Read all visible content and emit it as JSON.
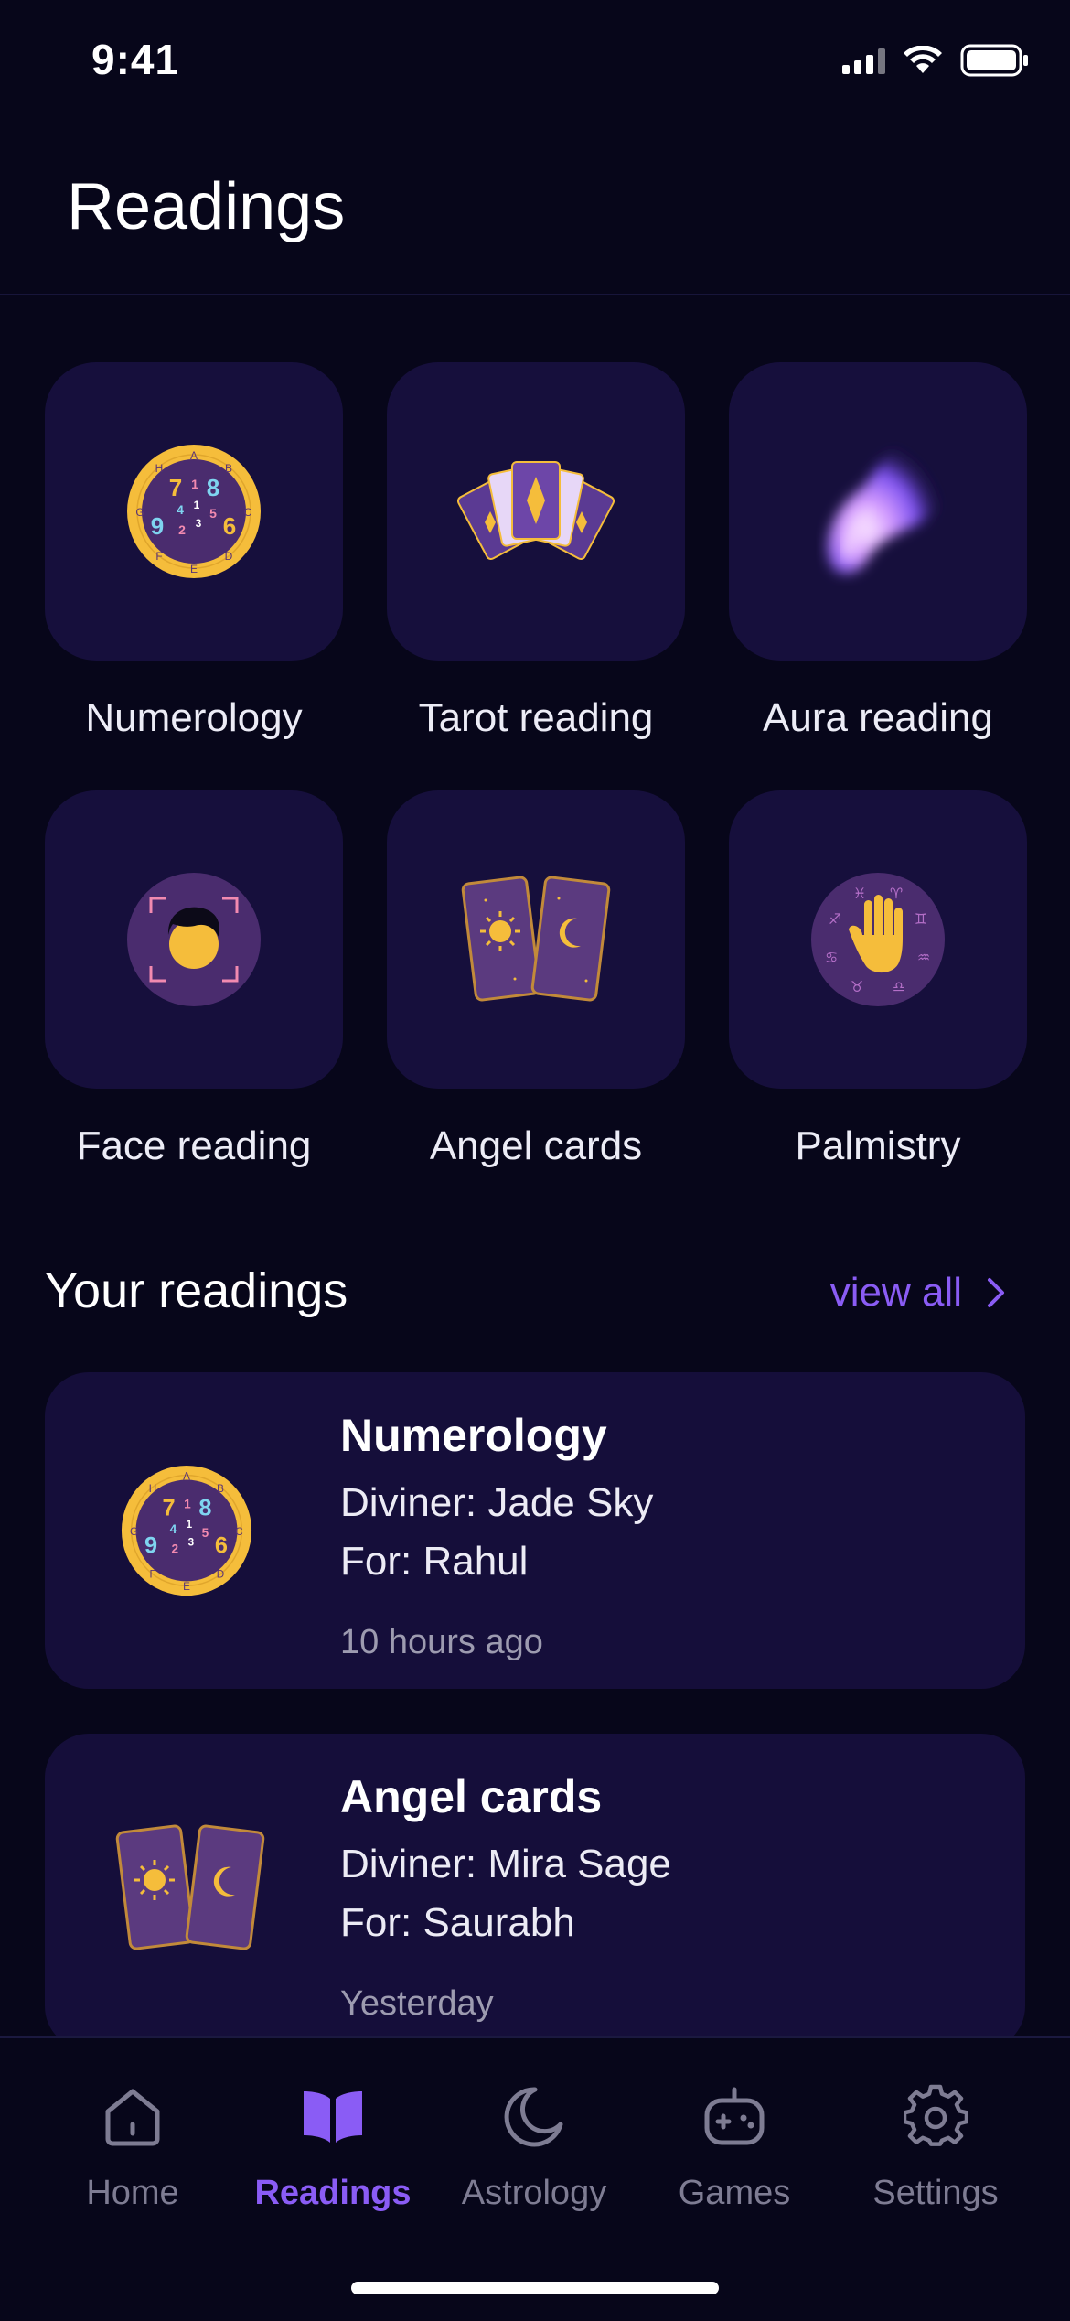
{
  "status_bar": {
    "time": "9:41"
  },
  "header": {
    "title": "Readings"
  },
  "reading_types": [
    {
      "label": "Numerology",
      "icon": "numerology-wheel-icon"
    },
    {
      "label": "Tarot reading",
      "icon": "tarot-cards-icon"
    },
    {
      "label": "Aura reading",
      "icon": "aura-flame-icon"
    },
    {
      "label": "Face reading",
      "icon": "face-scan-icon"
    },
    {
      "label": "Angel cards",
      "icon": "angel-cards-icon"
    },
    {
      "label": "Palmistry",
      "icon": "palm-zodiac-icon"
    }
  ],
  "your_readings": {
    "title": "Your readings",
    "view_all": "view all",
    "items": [
      {
        "title": "Numerology",
        "diviner": "Diviner: Jade Sky",
        "for": "For: Rahul",
        "time": "10 hours ago",
        "icon": "numerology-wheel-icon"
      },
      {
        "title": "Angel cards",
        "diviner": "Diviner: Mira Sage",
        "for": "For: Saurabh",
        "time": "Yesterday",
        "icon": "angel-cards-icon"
      }
    ]
  },
  "tab_bar": {
    "tabs": [
      {
        "label": "Home",
        "icon": "home-icon",
        "active": false
      },
      {
        "label": "Readings",
        "icon": "book-icon",
        "active": true
      },
      {
        "label": "Astrology",
        "icon": "moon-icon",
        "active": false
      },
      {
        "label": "Games",
        "icon": "gamepad-icon",
        "active": false
      },
      {
        "label": "Settings",
        "icon": "gear-icon",
        "active": false
      }
    ]
  },
  "colors": {
    "background": "#07061a",
    "card": "#150e3a",
    "accent": "#8a5cf5",
    "gold": "#f5bd3b",
    "purple_dark": "#4a2c6e"
  },
  "numerology_wheel": {
    "letters": [
      "H",
      "A",
      "B",
      "C",
      "D",
      "E",
      "F",
      "G"
    ],
    "digits": [
      "7",
      "1",
      "8",
      "4",
      "1",
      "5",
      "9",
      "2",
      "6",
      "3"
    ]
  }
}
